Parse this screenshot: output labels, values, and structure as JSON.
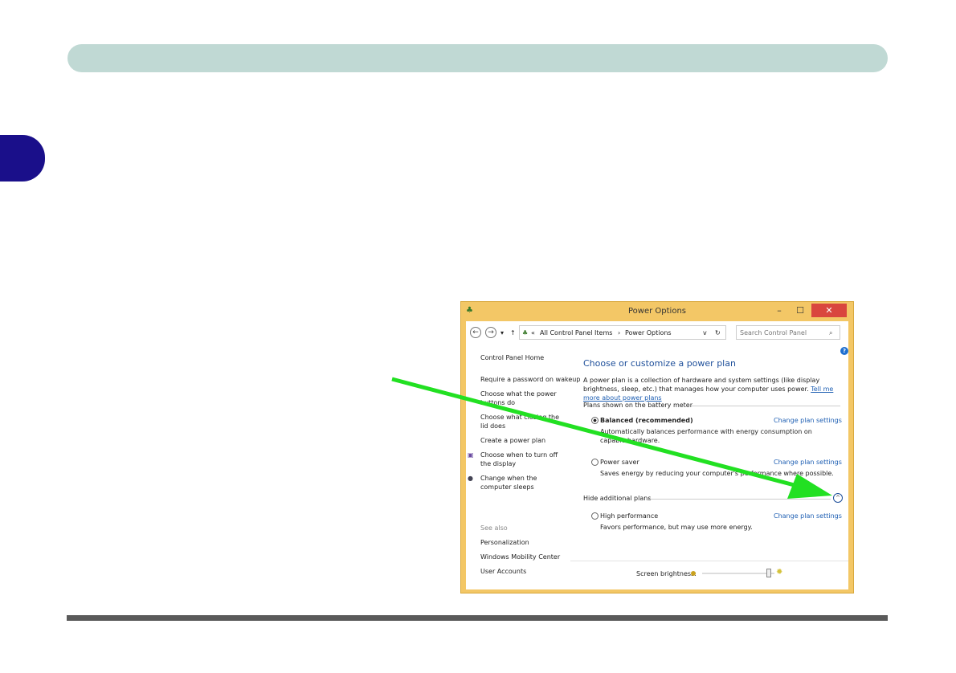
{
  "window": {
    "title": "Power Options",
    "minimize": "–",
    "maximize": "☐",
    "close": "✕"
  },
  "address": {
    "prefix": "«",
    "crumb1": "All Control Panel Items",
    "sep": "›",
    "crumb2": "Power Options",
    "dropdown": "v",
    "refresh": "↻"
  },
  "search": {
    "placeholder": "Search Control Panel",
    "icon": "search-icon"
  },
  "nav": {
    "back": "←",
    "forward": "→",
    "recent": "▾",
    "up": "↑",
    "help": "?"
  },
  "sidebar": {
    "home": "Control Panel Home",
    "items": [
      "Require a password on wakeup",
      "Choose what the power buttons do",
      "Choose what closing the lid does",
      "Create a power plan",
      "Choose when to turn off the display",
      "Change when the computer sleeps"
    ],
    "see_also": "See also",
    "see_also_items": [
      "Personalization",
      "Windows Mobility Center",
      "User Accounts"
    ]
  },
  "main": {
    "heading": "Choose or customize a power plan",
    "intro": "A power plan is a collection of hardware and system settings (like display brightness, sleep, etc.) that manages how your computer uses power.",
    "intro_link": "Tell me more about power plans",
    "section1": "Plans shown on the battery meter",
    "section2": "Hide additional plans",
    "plans": [
      {
        "name": "Balanced (recommended)",
        "desc": "Automatically balances performance with energy consumption on capable hardware.",
        "selected": true,
        "link": "Change plan settings"
      },
      {
        "name": "Power saver",
        "desc": "Saves energy by reducing your computer's performance where possible.",
        "selected": false,
        "link": "Change plan settings"
      },
      {
        "name": "High performance",
        "desc": "Favors performance, but may use more energy.",
        "selected": false,
        "link": "Change plan settings"
      }
    ],
    "brightness_label": "Screen brightness:",
    "brightness_level": 0.95
  },
  "colors": {
    "header": "#c0d9d4",
    "tab": "#1a0f8a",
    "arrow": "#22e022",
    "titlebar": "#f3c766",
    "link": "#1e5fb3"
  }
}
